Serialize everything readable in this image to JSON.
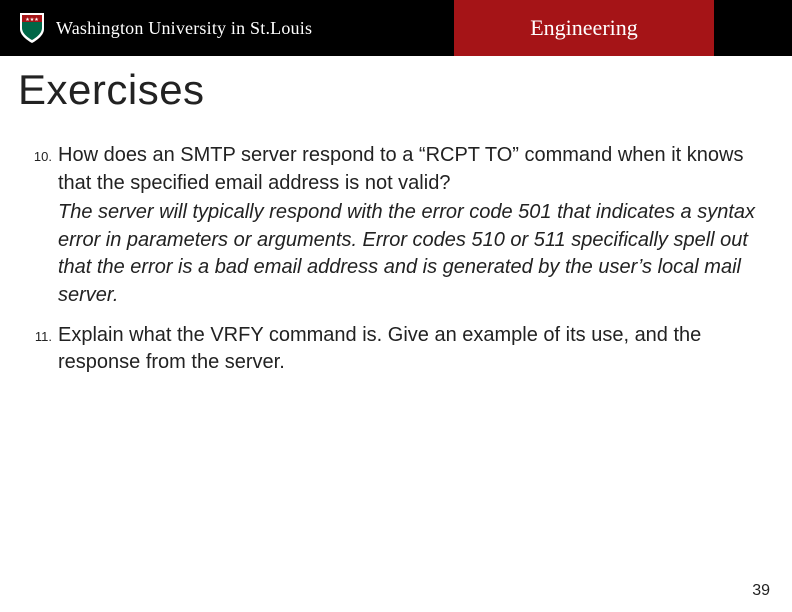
{
  "header": {
    "logo_main": "Washington University in St.Louis",
    "engineering_label": "Engineering"
  },
  "title": "Exercises",
  "exercises": [
    {
      "number": "10.",
      "question": "How does an SMTP server respond to a “RCPT TO” command when it knows that the specified email address is not valid?",
      "answer": "The server will typically respond with the error code 501 that indicates a syntax error in parameters or arguments.  Error codes 510 or 511 specifically spell out that the error is a bad email address and is generated by the user’s local mail server."
    },
    {
      "number": "11.",
      "question": "Explain what the VRFY command is. Give an example of its use, and the response from the server.",
      "answer": ""
    }
  ],
  "page_number": "39"
}
